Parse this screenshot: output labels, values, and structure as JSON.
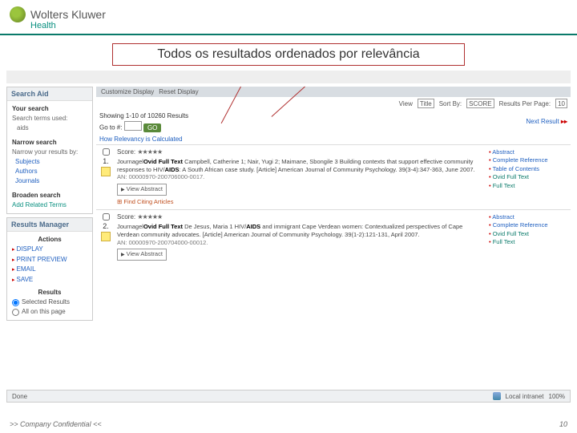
{
  "brand": {
    "main": "Wolters Kluwer",
    "sub": "Health"
  },
  "callout": "Todos os resultados ordenados por relevância",
  "search_aid": {
    "header": "Search Aid",
    "your_search": "Your search",
    "terms_label": "Search terms used:",
    "terms": "aids",
    "narrow": "Narrow search",
    "narrow_label": "Narrow your results by:",
    "narrow_items": [
      "Subjects",
      "Authors",
      "Journals"
    ],
    "broaden": "Broaden search",
    "add_related": "Add Related Terms"
  },
  "results_mgr": {
    "header": "Results Manager",
    "actions": "Actions",
    "items": [
      "DISPLAY",
      "PRINT PREVIEW",
      "EMAIL",
      "SAVE"
    ],
    "results": "Results",
    "selected": "Selected Results",
    "all_page": "All on this page"
  },
  "toolbar": {
    "customize": "Customize Display",
    "reset": "Reset Display"
  },
  "topctrl": {
    "view": "View",
    "view_opt": "Title",
    "sort": "Sort By:",
    "sort_opt": "SCORE",
    "rpp": "Results Per Page:",
    "rpp_opt": "10"
  },
  "pager": {
    "showing": "Showing 1-10 of 10260 Results",
    "goto": "Go to #:",
    "go": "GO",
    "next": "Next Result",
    "relevance": "How Relevancy is Calculated"
  },
  "results": [
    {
      "n": "1.",
      "score": "Score: ",
      "stars": "★★★★★",
      "text": "Journagel[b]Ovid Full Text[/b] Campbell, Catherine 1; Nair, Yugi 2; Maimane, Sbongile 3 Building contexts that support effective community responses to HIV/[b]AIDS[/b]: A South African case study. [Article] American Journal of Community Psychology. 39(3-4):347-363, June 2007.",
      "an": "AN: 00000970-200706000-0017.",
      "citing": "Find Citing Articles",
      "abstract": "View Abstract",
      "links": [
        "Abstract",
        "Complete Reference",
        "Table of Contents",
        "Ovid Full Text",
        "Full Text"
      ]
    },
    {
      "n": "2.",
      "score": "Score: ",
      "stars": "★★★★★",
      "text": "Journagel[b]Ovid Full Text[/b] De Jesus, Maria 1 HIV/[b]AIDS[/b] and immigrant Cape Verdean women: Contextualized perspectives of Cape Verdean community advocates. [Article] American Journal of Community Psychology. 39(1-2):121-131, April 2007.",
      "an": "AN: 00000970-200704000-00012.",
      "citing": "",
      "abstract": "View Abstract",
      "links": [
        "Abstract",
        "Complete Reference",
        "Ovid Full Text",
        "Full Text"
      ]
    }
  ],
  "status": {
    "done": "Done",
    "zone": "Local intranet",
    "zoom": "100%"
  },
  "footer": {
    "conf": ">> Company Confidential <<",
    "page": "10"
  }
}
